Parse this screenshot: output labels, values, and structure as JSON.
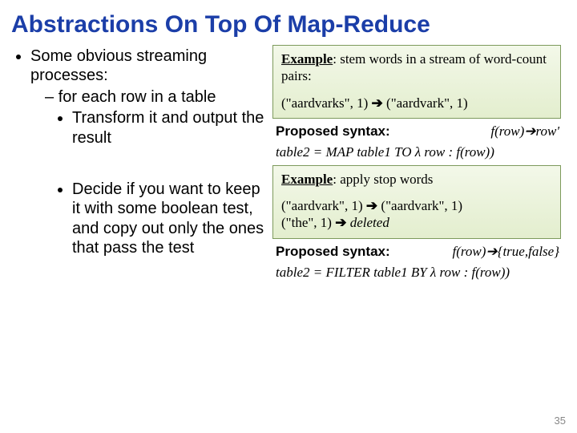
{
  "title": "Abstractions On Top Of Map-Reduce",
  "bullets": {
    "top": "Some obvious streaming processes:",
    "sub1": "for each row in a table",
    "sub1a": "Transform it and output the result",
    "sub1b": "Decide if you want to keep it with some boolean test, and copy out only the ones that pass the test"
  },
  "example1": {
    "label": "Example",
    "text": ": stem words in a stream of word-count pairs:",
    "trans_l": "(\"aardvarks\", 1)",
    "arrow": "➔",
    "trans_r": "(\"aardvark\", 1)"
  },
  "syntax1": {
    "label": "Proposed syntax:",
    "val": "f(row)➔row'"
  },
  "code1": "table2 = MAP table1 TO λ row : f(row))",
  "example2": {
    "label": "Example",
    "text": ": apply stop words",
    "t1l": "(\"aardvark\", 1)",
    "arrow": "➔",
    "t1r": "(\"aardvark\", 1)",
    "t2l": "(\"the\", 1)",
    "t2r": "deleted"
  },
  "syntax2": {
    "label": "Proposed syntax:",
    "val": "f(row)➔{true,false}"
  },
  "code2": "table2 = FILTER table1 BY λ row : f(row))",
  "pagenum": "35"
}
